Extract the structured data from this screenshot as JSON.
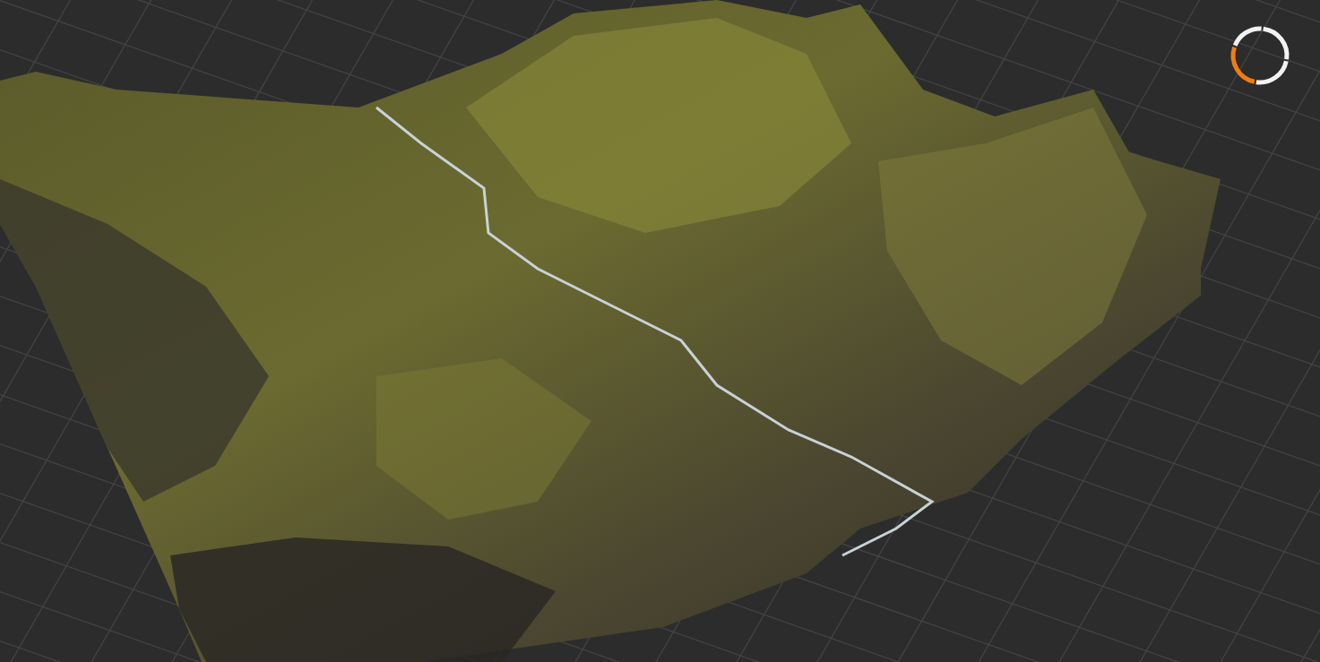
{
  "viewport": {
    "view_gizmo": {
      "segments": [
        {
          "selected": false
        },
        {
          "selected": false
        },
        {
          "selected": true
        },
        {
          "selected": false
        }
      ]
    }
  }
}
